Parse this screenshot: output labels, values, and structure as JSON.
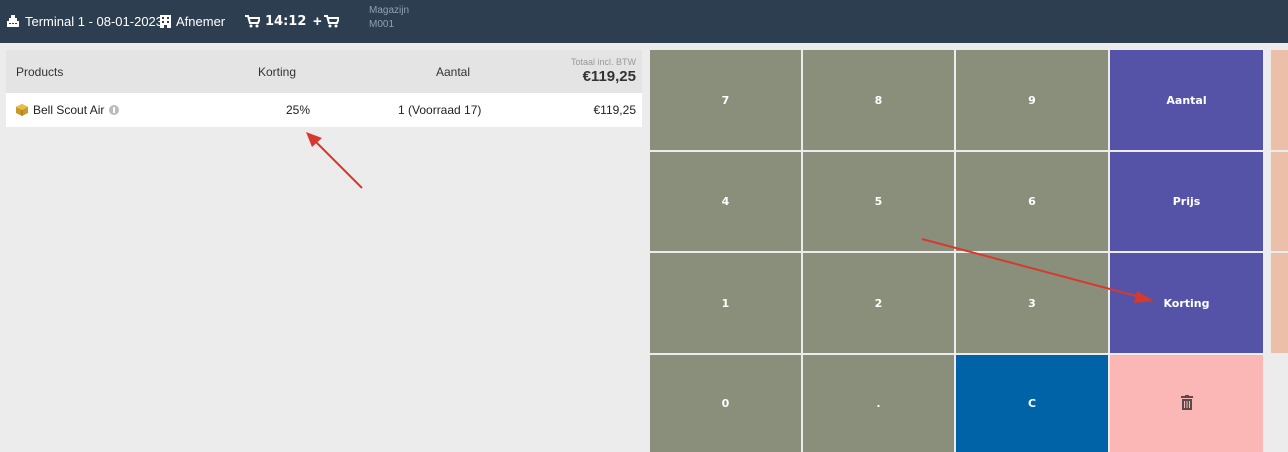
{
  "topbar": {
    "terminal_label": "Terminal 1 - 08-01-2023",
    "customer_label": "Afnemer",
    "cart_time": "14:12",
    "add_cart_label": "+",
    "warehouse_label": "Magazijn",
    "warehouse_value": "M001"
  },
  "table": {
    "headers": {
      "products": "Products",
      "korting": "Korting",
      "aantal": "Aantal",
      "total_caption": "Totaal incl. BTW",
      "total_value": "€119,25"
    },
    "rows": [
      {
        "name": "Bell Scout Air",
        "korting": "25%",
        "aantal": "1 (Voorraad 17)",
        "price": "€119,25"
      }
    ]
  },
  "keypad": {
    "k7": "7",
    "k8": "8",
    "k9": "9",
    "k4": "4",
    "k5": "5",
    "k6": "6",
    "k1": "1",
    "k2": "2",
    "k3": "3",
    "k0": "0",
    "kdot": ".",
    "kc": "C",
    "aantal": "Aantal",
    "prijs": "Prijs",
    "korting": "Korting"
  },
  "colors": {
    "topbar": "#2c3e50",
    "number_key": "#8a8f7b",
    "function_key": "#5553a8",
    "clear_key": "#0063a8",
    "delete_key": "#fbb6b6",
    "annotation_arrow": "#d63a2e"
  },
  "icons": {
    "terminal": "cash-register-icon",
    "customer": "building-icon",
    "cart": "cart-icon",
    "product": "box-icon",
    "delete": "trash-icon",
    "info": "info-icon"
  }
}
